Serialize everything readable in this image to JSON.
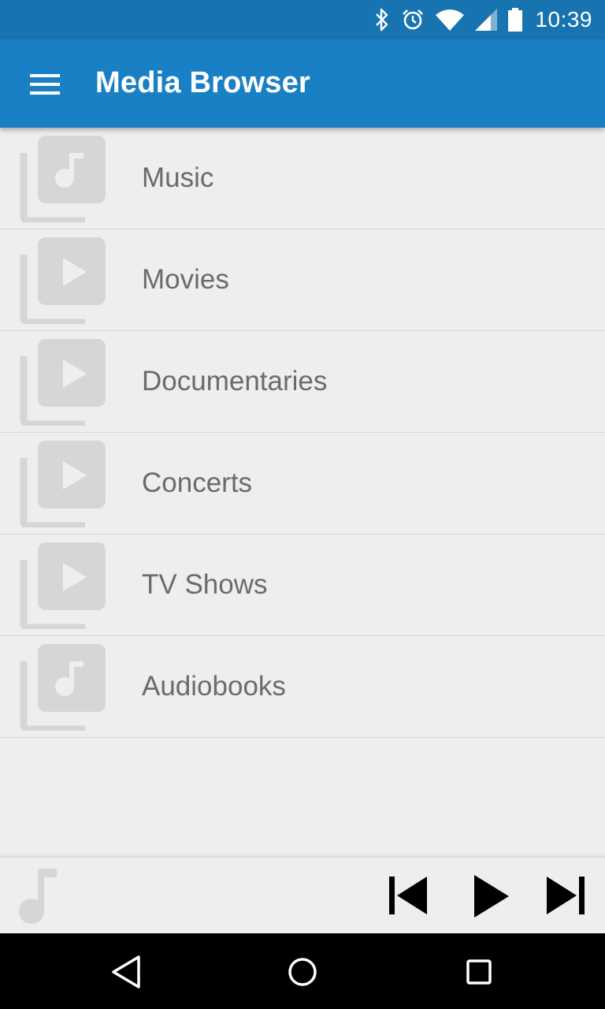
{
  "status_bar": {
    "time": "10:39",
    "icons": [
      "bluetooth-icon",
      "alarm-icon",
      "wifi-icon",
      "cellular-signal-icon",
      "battery-icon"
    ]
  },
  "app_bar": {
    "title": "Media Browser",
    "menu_icon": "hamburger-menu-icon",
    "color": "#1a80c5"
  },
  "categories": [
    {
      "label": "Music",
      "icon": "music-library-icon"
    },
    {
      "label": "Movies",
      "icon": "video-library-icon"
    },
    {
      "label": "Documentaries",
      "icon": "video-library-icon"
    },
    {
      "label": "Concerts",
      "icon": "video-library-icon"
    },
    {
      "label": "TV Shows",
      "icon": "video-library-icon"
    },
    {
      "label": "Audiobooks",
      "icon": "music-library-icon"
    }
  ],
  "player": {
    "now_playing_icon": "music-note-icon",
    "controls": [
      "skip-previous-icon",
      "play-icon",
      "skip-next-icon"
    ]
  },
  "navigation": {
    "buttons": [
      "back-icon",
      "home-icon",
      "recents-icon"
    ]
  },
  "colors": {
    "status_bar": "#1874b0",
    "app_bar": "#1a80c5",
    "list_background": "#eeeeee",
    "label_text": "#6b6b6b",
    "icon_grey": "#d6d6d6"
  }
}
